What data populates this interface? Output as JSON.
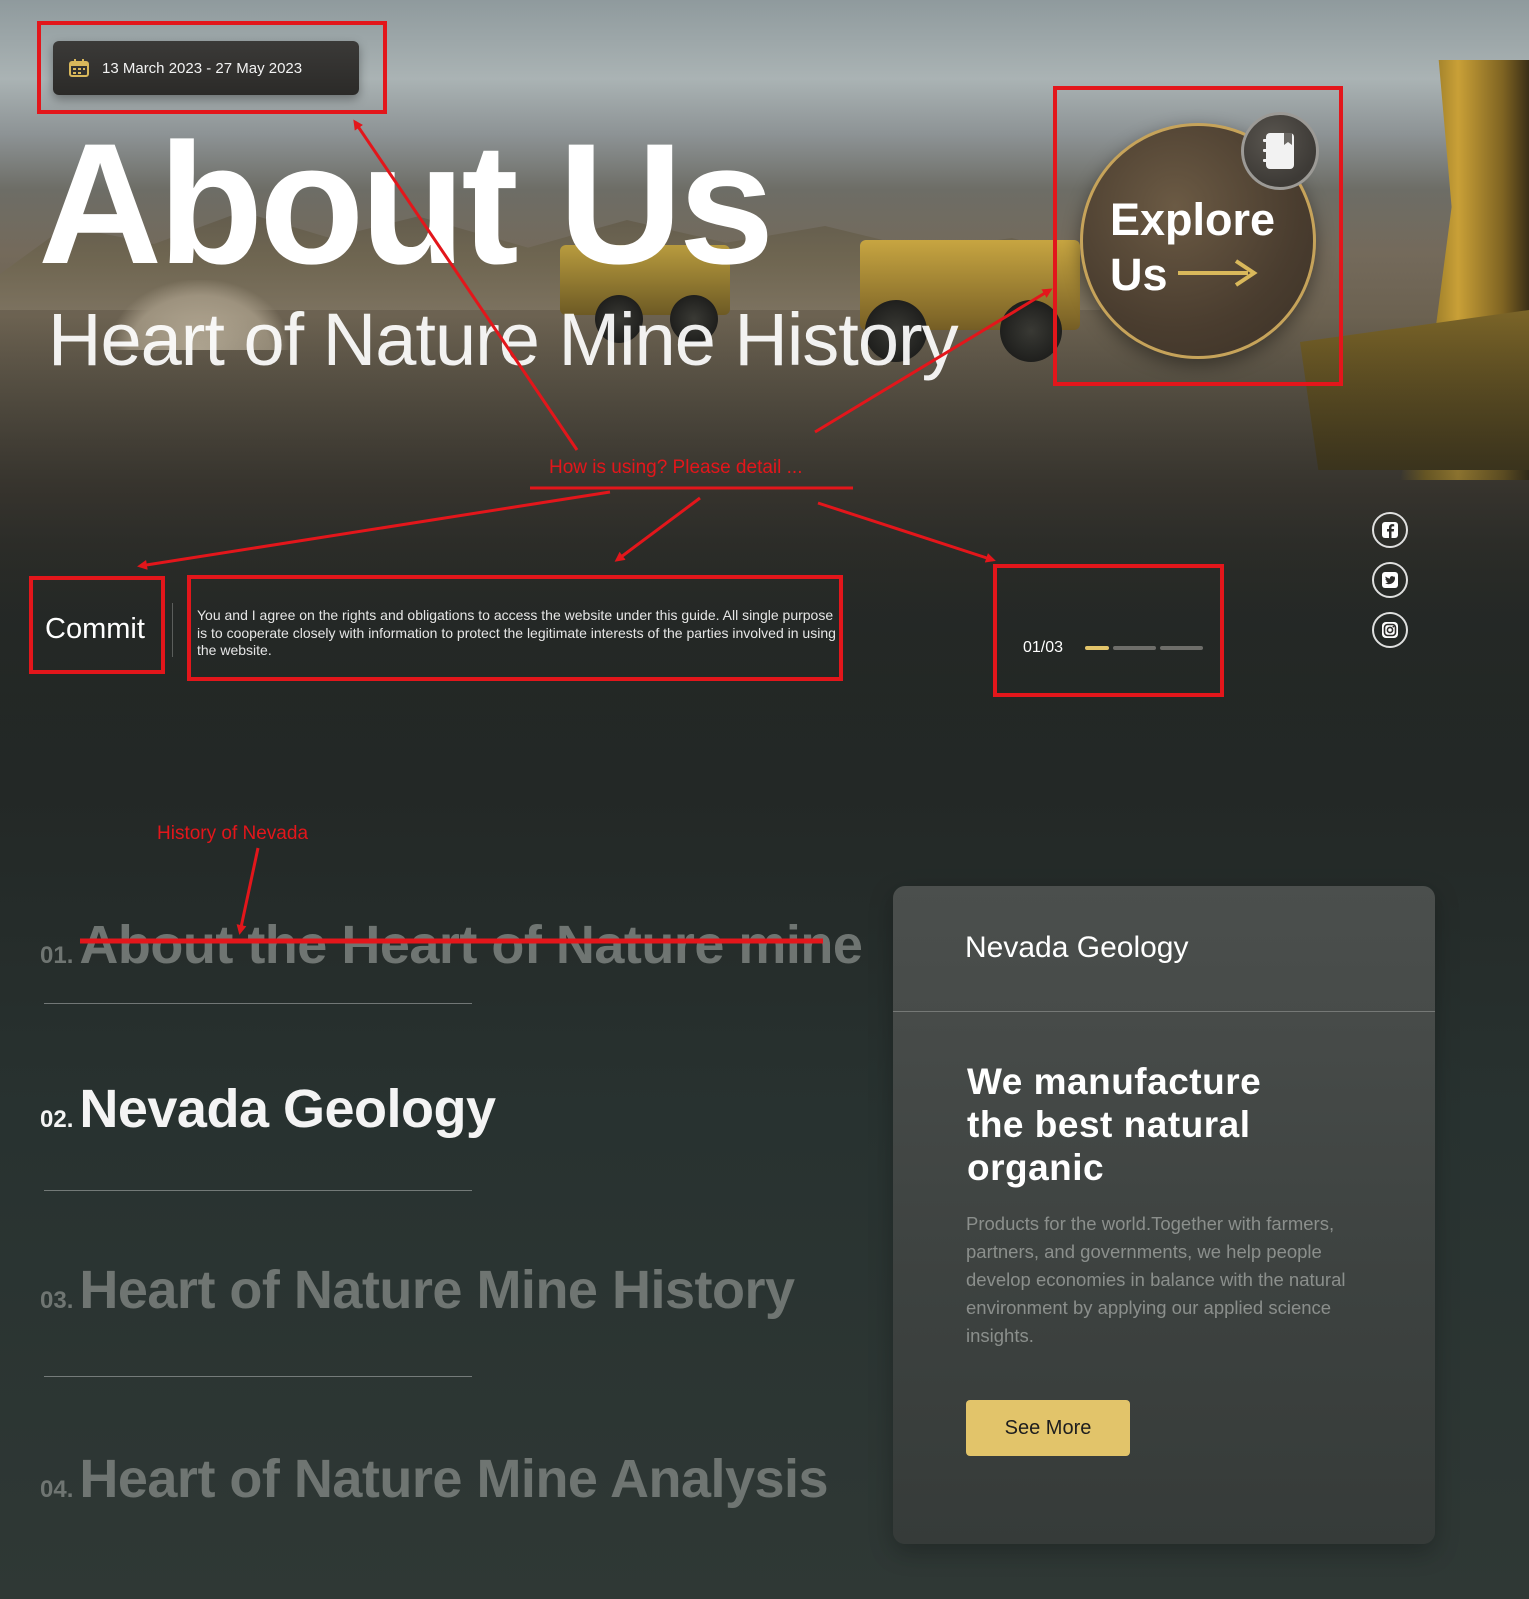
{
  "hero": {
    "date_range": "13 March 2023 - 27 May 2023",
    "title": "About Us",
    "subtitle": "Heart of Nature Mine History",
    "explore": {
      "line1": "Explore",
      "line2": "Us"
    },
    "commit": {
      "label": "Commit",
      "text": "You and I agree on the rights and obligations to access the website under this guide. All single purpose is to cooperate closely with information to protect the legitimate interests of the parties involved in using the website."
    },
    "pager": {
      "text": "01/03",
      "current": 1,
      "total": 3
    },
    "social": [
      "facebook-icon",
      "twitter-icon",
      "instagram-icon"
    ]
  },
  "annotations": {
    "hero_note": "How is using? Please detail ...",
    "history_note": "History of Nevada"
  },
  "menu": {
    "items": [
      {
        "num": "01.",
        "label": "About the Heart of Nature mine",
        "struck": true
      },
      {
        "num": "02.",
        "label": "Nevada Geology",
        "active": true
      },
      {
        "num": "03.",
        "label": "Heart of Nature Mine History"
      },
      {
        "num": "04.",
        "label": "Heart of Nature Mine Analysis"
      }
    ]
  },
  "card": {
    "title": "Nevada Geology",
    "heading": "We manufacture the best natural organic",
    "body": "Products for the world.Together with farmers, partners, and governments, we help people develop economies in balance with the natural environment by applying our applied science insights.",
    "button": "See More"
  },
  "colors": {
    "accent_gold": "#e2c46a",
    "annotation_red": "#e3161b",
    "background_dark": "#25292a"
  }
}
